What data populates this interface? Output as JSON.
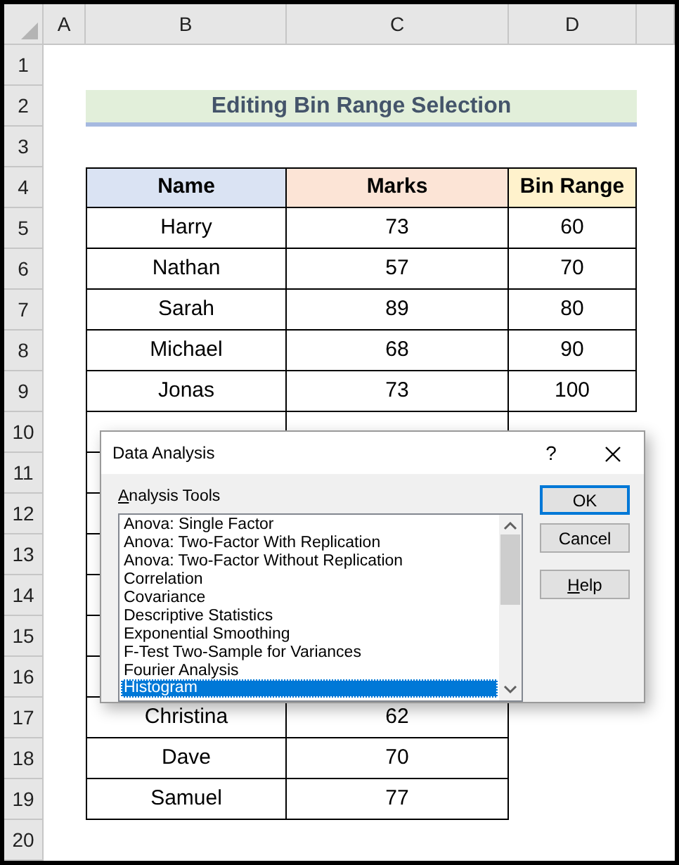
{
  "column_headers": [
    "A",
    "B",
    "C",
    "D"
  ],
  "rows": [
    {
      "number": "1",
      "kind": "blank"
    },
    {
      "number": "2",
      "kind": "title",
      "title": "Editing Bin Range Selection"
    },
    {
      "number": "3",
      "kind": "blank"
    },
    {
      "number": "4",
      "kind": "header",
      "headers": [
        {
          "text": "Name",
          "color": "#dae3f3"
        },
        {
          "text": "Marks",
          "color": "#fce4d6"
        },
        {
          "text": "Bin Range",
          "color": "#fff2cc"
        }
      ]
    },
    {
      "number": "5",
      "kind": "data",
      "cells": [
        "Harry",
        "73",
        "60"
      ]
    },
    {
      "number": "6",
      "kind": "data",
      "cells": [
        "Nathan",
        "57",
        "70"
      ]
    },
    {
      "number": "7",
      "kind": "data",
      "cells": [
        "Sarah",
        "89",
        "80"
      ]
    },
    {
      "number": "8",
      "kind": "data",
      "cells": [
        "Michael",
        "68",
        "90"
      ]
    },
    {
      "number": "9",
      "kind": "data",
      "cells": [
        "Jonas",
        "73",
        "100"
      ]
    },
    {
      "number": "10",
      "kind": "data"
    },
    {
      "number": "11",
      "kind": "data"
    },
    {
      "number": "12",
      "kind": "data"
    },
    {
      "number": "13",
      "kind": "data"
    },
    {
      "number": "14",
      "kind": "data"
    },
    {
      "number": "15",
      "kind": "data"
    },
    {
      "number": "16",
      "kind": "data"
    },
    {
      "number": "17",
      "kind": "data",
      "cells": [
        "Christina",
        "62"
      ]
    },
    {
      "number": "18",
      "kind": "data",
      "cells": [
        "Dave",
        "70"
      ]
    },
    {
      "number": "19",
      "kind": "data",
      "cells": [
        "Samuel",
        "77"
      ]
    },
    {
      "number": "20",
      "kind": "blank"
    }
  ],
  "dialog": {
    "title": "Data Analysis",
    "help": "?",
    "list_label": "Analysis Tools",
    "items": [
      {
        "label": "Anova: Single Factor",
        "selected": false
      },
      {
        "label": "Anova: Two-Factor With Replication",
        "selected": false
      },
      {
        "label": "Anova: Two-Factor Without Replication",
        "selected": false
      },
      {
        "label": "Correlation",
        "selected": false
      },
      {
        "label": "Covariance",
        "selected": false
      },
      {
        "label": "Descriptive Statistics",
        "selected": false
      },
      {
        "label": "Exponential Smoothing",
        "selected": false
      },
      {
        "label": "F-Test Two-Sample for Variances",
        "selected": false
      },
      {
        "label": "Fourier Analysis",
        "selected": false
      },
      {
        "label": "Histogram",
        "selected": true
      }
    ],
    "buttons": [
      {
        "label": "OK",
        "default": true
      },
      {
        "label": "Cancel",
        "default": false
      },
      {
        "label": "Help",
        "default": false
      }
    ]
  }
}
